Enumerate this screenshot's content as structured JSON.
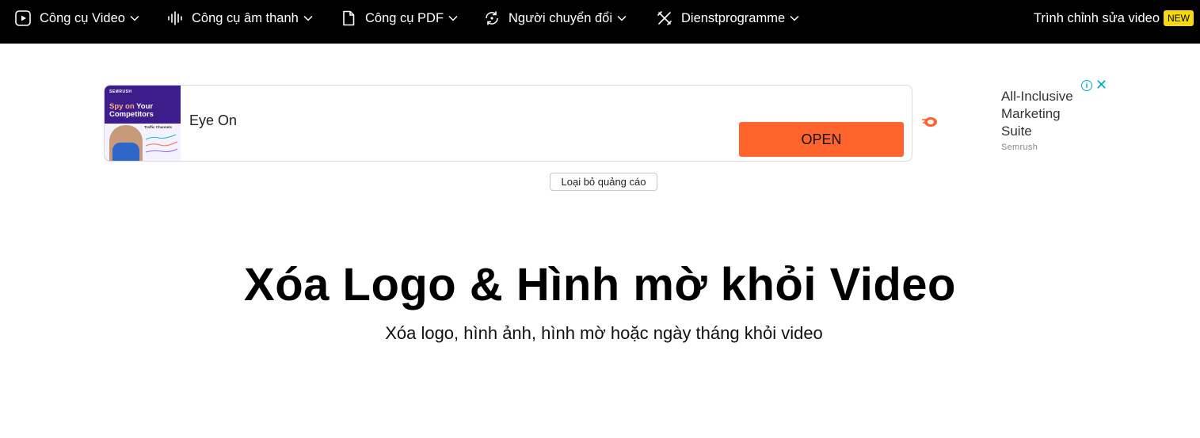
{
  "nav": {
    "items": [
      {
        "label": "Công cụ Video",
        "icon": "play-circle-icon"
      },
      {
        "label": "Công cụ âm thanh",
        "icon": "sound-wave-icon"
      },
      {
        "label": "Công cụ PDF",
        "icon": "file-icon"
      },
      {
        "label": "Người chuyển đổi",
        "icon": "convert-cycle-icon"
      },
      {
        "label": "Dienstprogramme",
        "icon": "tools-icon"
      }
    ],
    "right_label": "Trình chỉnh sửa video",
    "new_badge": "NEW"
  },
  "ad": {
    "thumb_brand": "SEMRUSH",
    "thumb_headline_highlight": "Spy on",
    "thumb_headline_rest": "Your Competitors",
    "thumb_caption": "Traffic Channels",
    "headline": "Eye On",
    "cta": "OPEN",
    "side_text": "All-Inclusive Marketing Suite",
    "side_brand": "Semrush",
    "info_glyph": "i",
    "close_glyph": "✕",
    "accent": "#ff642d"
  },
  "remove_ads_label": "Loại bỏ quảng cáo",
  "hero": {
    "title": "Xóa Logo & Hình mờ khỏi Video",
    "subtitle": "Xóa logo, hình ảnh, hình mờ hoặc ngày tháng khỏi video"
  }
}
